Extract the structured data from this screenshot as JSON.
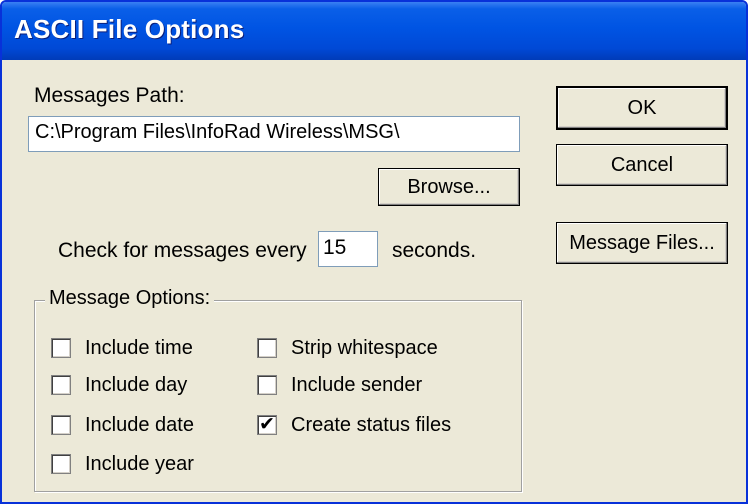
{
  "window": {
    "title": "ASCII File Options"
  },
  "path": {
    "label": "Messages Path:",
    "value": "C:\\Program Files\\InfoRad Wireless\\MSG\\",
    "browse_label": "Browse..."
  },
  "interval": {
    "prefix": "Check for messages every",
    "value": "15",
    "suffix": "seconds."
  },
  "buttons": {
    "ok": "OK",
    "cancel": "Cancel",
    "message_files": "Message Files..."
  },
  "options": {
    "title": "Message Options:",
    "include_time": {
      "label": "Include time",
      "checked": false
    },
    "include_day": {
      "label": "Include day",
      "checked": false
    },
    "include_date": {
      "label": "Include date",
      "checked": false
    },
    "include_year": {
      "label": "Include year",
      "checked": false
    },
    "strip_whitespace": {
      "label": "Strip whitespace",
      "checked": false
    },
    "include_sender": {
      "label": "Include sender",
      "checked": false
    },
    "create_status_files": {
      "label": "Create status files",
      "checked": true
    }
  }
}
